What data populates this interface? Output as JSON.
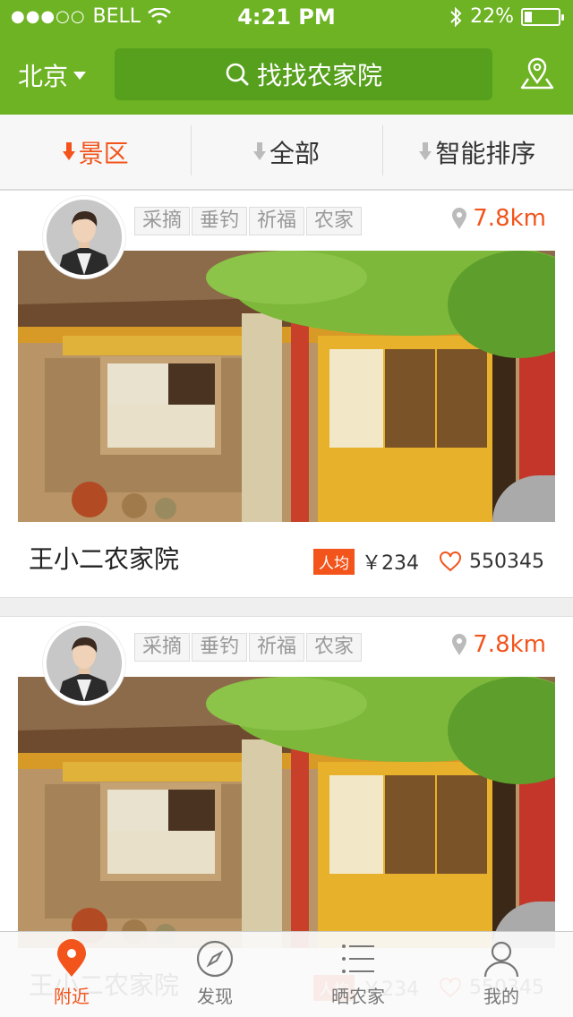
{
  "status_bar": {
    "signal_dots": "●●●○○",
    "carrier": "BELL",
    "time": "4:21 PM",
    "battery_percent": "22%",
    "battery_level": 0.22
  },
  "header": {
    "city": "北京",
    "search_placeholder": "找找农家院",
    "icons": [
      "search-icon",
      "location-pin-icon"
    ]
  },
  "filters": [
    {
      "label": "景区",
      "active": true
    },
    {
      "label": "全部",
      "active": false
    },
    {
      "label": "智能排序",
      "active": false
    }
  ],
  "listings": [
    {
      "tags": [
        "采摘",
        "垂钓",
        "祈福",
        "农家"
      ],
      "distance": "7.8km",
      "name": "王小二农家院",
      "badge": "人均",
      "price": "￥234",
      "likes": "550345"
    },
    {
      "tags": [
        "采摘",
        "垂钓",
        "祈福",
        "农家"
      ],
      "distance": "7.8km",
      "name": "王小二农家院",
      "badge": "人均",
      "price": "￥234",
      "likes": "550345"
    }
  ],
  "tabbar": [
    {
      "label": "附近",
      "icon": "location-pin-icon",
      "active": true
    },
    {
      "label": "发现",
      "icon": "compass-icon",
      "active": false
    },
    {
      "label": "晒农家",
      "icon": "list-icon",
      "active": false
    },
    {
      "label": "我的",
      "icon": "user-icon",
      "active": false
    }
  ],
  "colors": {
    "brand_green": "#6db324",
    "accent_orange": "#f2541c"
  }
}
